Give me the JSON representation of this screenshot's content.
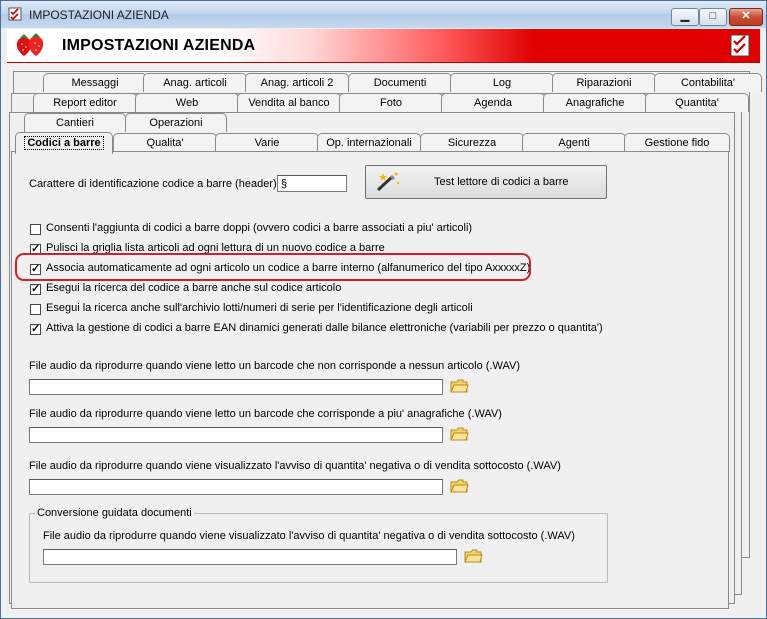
{
  "window": {
    "title": "IMPOSTAZIONI AZIENDA",
    "min": "▁",
    "max": "□",
    "close": "✕"
  },
  "header": {
    "title": "IMPOSTAZIONI AZIENDA"
  },
  "tabs": {
    "row1": [
      "Messaggi",
      "Anag. articoli",
      "Anag. articoli 2",
      "Documenti",
      "Log",
      "Riparazioni",
      "Contabilita'"
    ],
    "row2": [
      "Report editor",
      "Web",
      "Vendita al banco",
      "Foto",
      "Agenda",
      "Anagrafiche",
      "Quantita'"
    ],
    "row3": [
      "Cantieri",
      "Operazioni"
    ],
    "row4": [
      "Codici a barre",
      "Qualita'",
      "Varie",
      "Op. internazionali",
      "Sicurezza",
      "Agenti",
      "Gestione fido"
    ]
  },
  "barcode": {
    "header_label": "Carattere di identificazione codice a barre (header) :",
    "header_value": "§",
    "test_button": "Test lettore di codici a barre"
  },
  "options": [
    {
      "label": "Consenti l'aggiunta di codici a barre doppi (ovvero codici a barre associati a piu' articoli)",
      "checked": false
    },
    {
      "label": "Pulisci la griglia lista articoli ad ogni lettura di un nuovo codice a barre",
      "checked": true
    },
    {
      "label": "Associa automaticamente ad ogni articolo un codice a barre interno (alfanumerico del tipo AxxxxxZ)",
      "checked": true
    },
    {
      "label": "Esegui la ricerca del codice a barre anche sul codice articolo",
      "checked": true
    },
    {
      "label": "Esegui la ricerca anche sull'archivio lotti/numeri di serie per l'identificazione degli articoli",
      "checked": false
    },
    {
      "label": "Attiva la gestione di codici a barre EAN dinamici generati dalle bilance elettroniche (variabili per prezzo o quantita')",
      "checked": true
    }
  ],
  "audio": [
    {
      "label": "File audio da riprodurre quando viene letto un barcode che non corrisponde a nessun articolo (.WAV)",
      "value": ""
    },
    {
      "label": "File audio da riprodurre quando viene letto un barcode che corrisponde a piu' anagrafiche (.WAV)",
      "value": ""
    },
    {
      "label": "File audio da riprodurre quando viene visualizzato l'avviso di quantita' negativa o di vendita sottocosto (.WAV)",
      "value": ""
    }
  ],
  "conversion": {
    "title": "Conversione guidata documenti",
    "label": "File audio da riprodurre quando viene visualizzato l'avviso di quantita' negativa o di vendita sottocosto (.WAV)",
    "value": ""
  }
}
